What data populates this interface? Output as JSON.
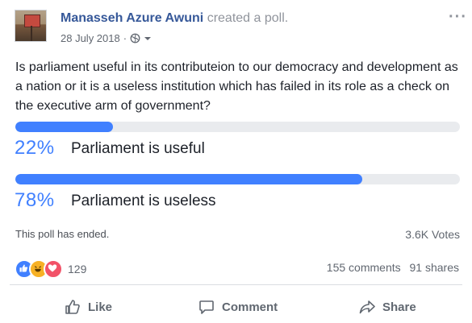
{
  "post": {
    "author": "Manasseh Azure Awuni",
    "action": "created a poll.",
    "date": "28 July 2018",
    "separator": "·",
    "audience_icon": "globe-icon",
    "more_icon": "more-icon"
  },
  "poll": {
    "question": "Is parliament useful in its contributeion to our democracy and development as a nation or it is a useless institution which has failed in its role as a check on the executive arm of government?",
    "options": [
      {
        "percent_label": "22%",
        "percent": 22,
        "label": "Parliament is useful"
      },
      {
        "percent_label": "78%",
        "percent": 78,
        "label": "Parliament is useless"
      }
    ],
    "status": "This poll has ended.",
    "votes": "3.6K Votes",
    "bar_color": "#4080ff",
    "track_color": "#e9ebee"
  },
  "engagement": {
    "reaction_icons": [
      "like-icon",
      "haha-icon",
      "love-icon"
    ],
    "reaction_count": "129",
    "comments": "155 comments",
    "shares": "91 shares"
  },
  "actions": {
    "like": "Like",
    "comment": "Comment",
    "share": "Share"
  },
  "colors": {
    "link": "#365899",
    "accent": "#4080ff",
    "muted": "#90949c"
  }
}
